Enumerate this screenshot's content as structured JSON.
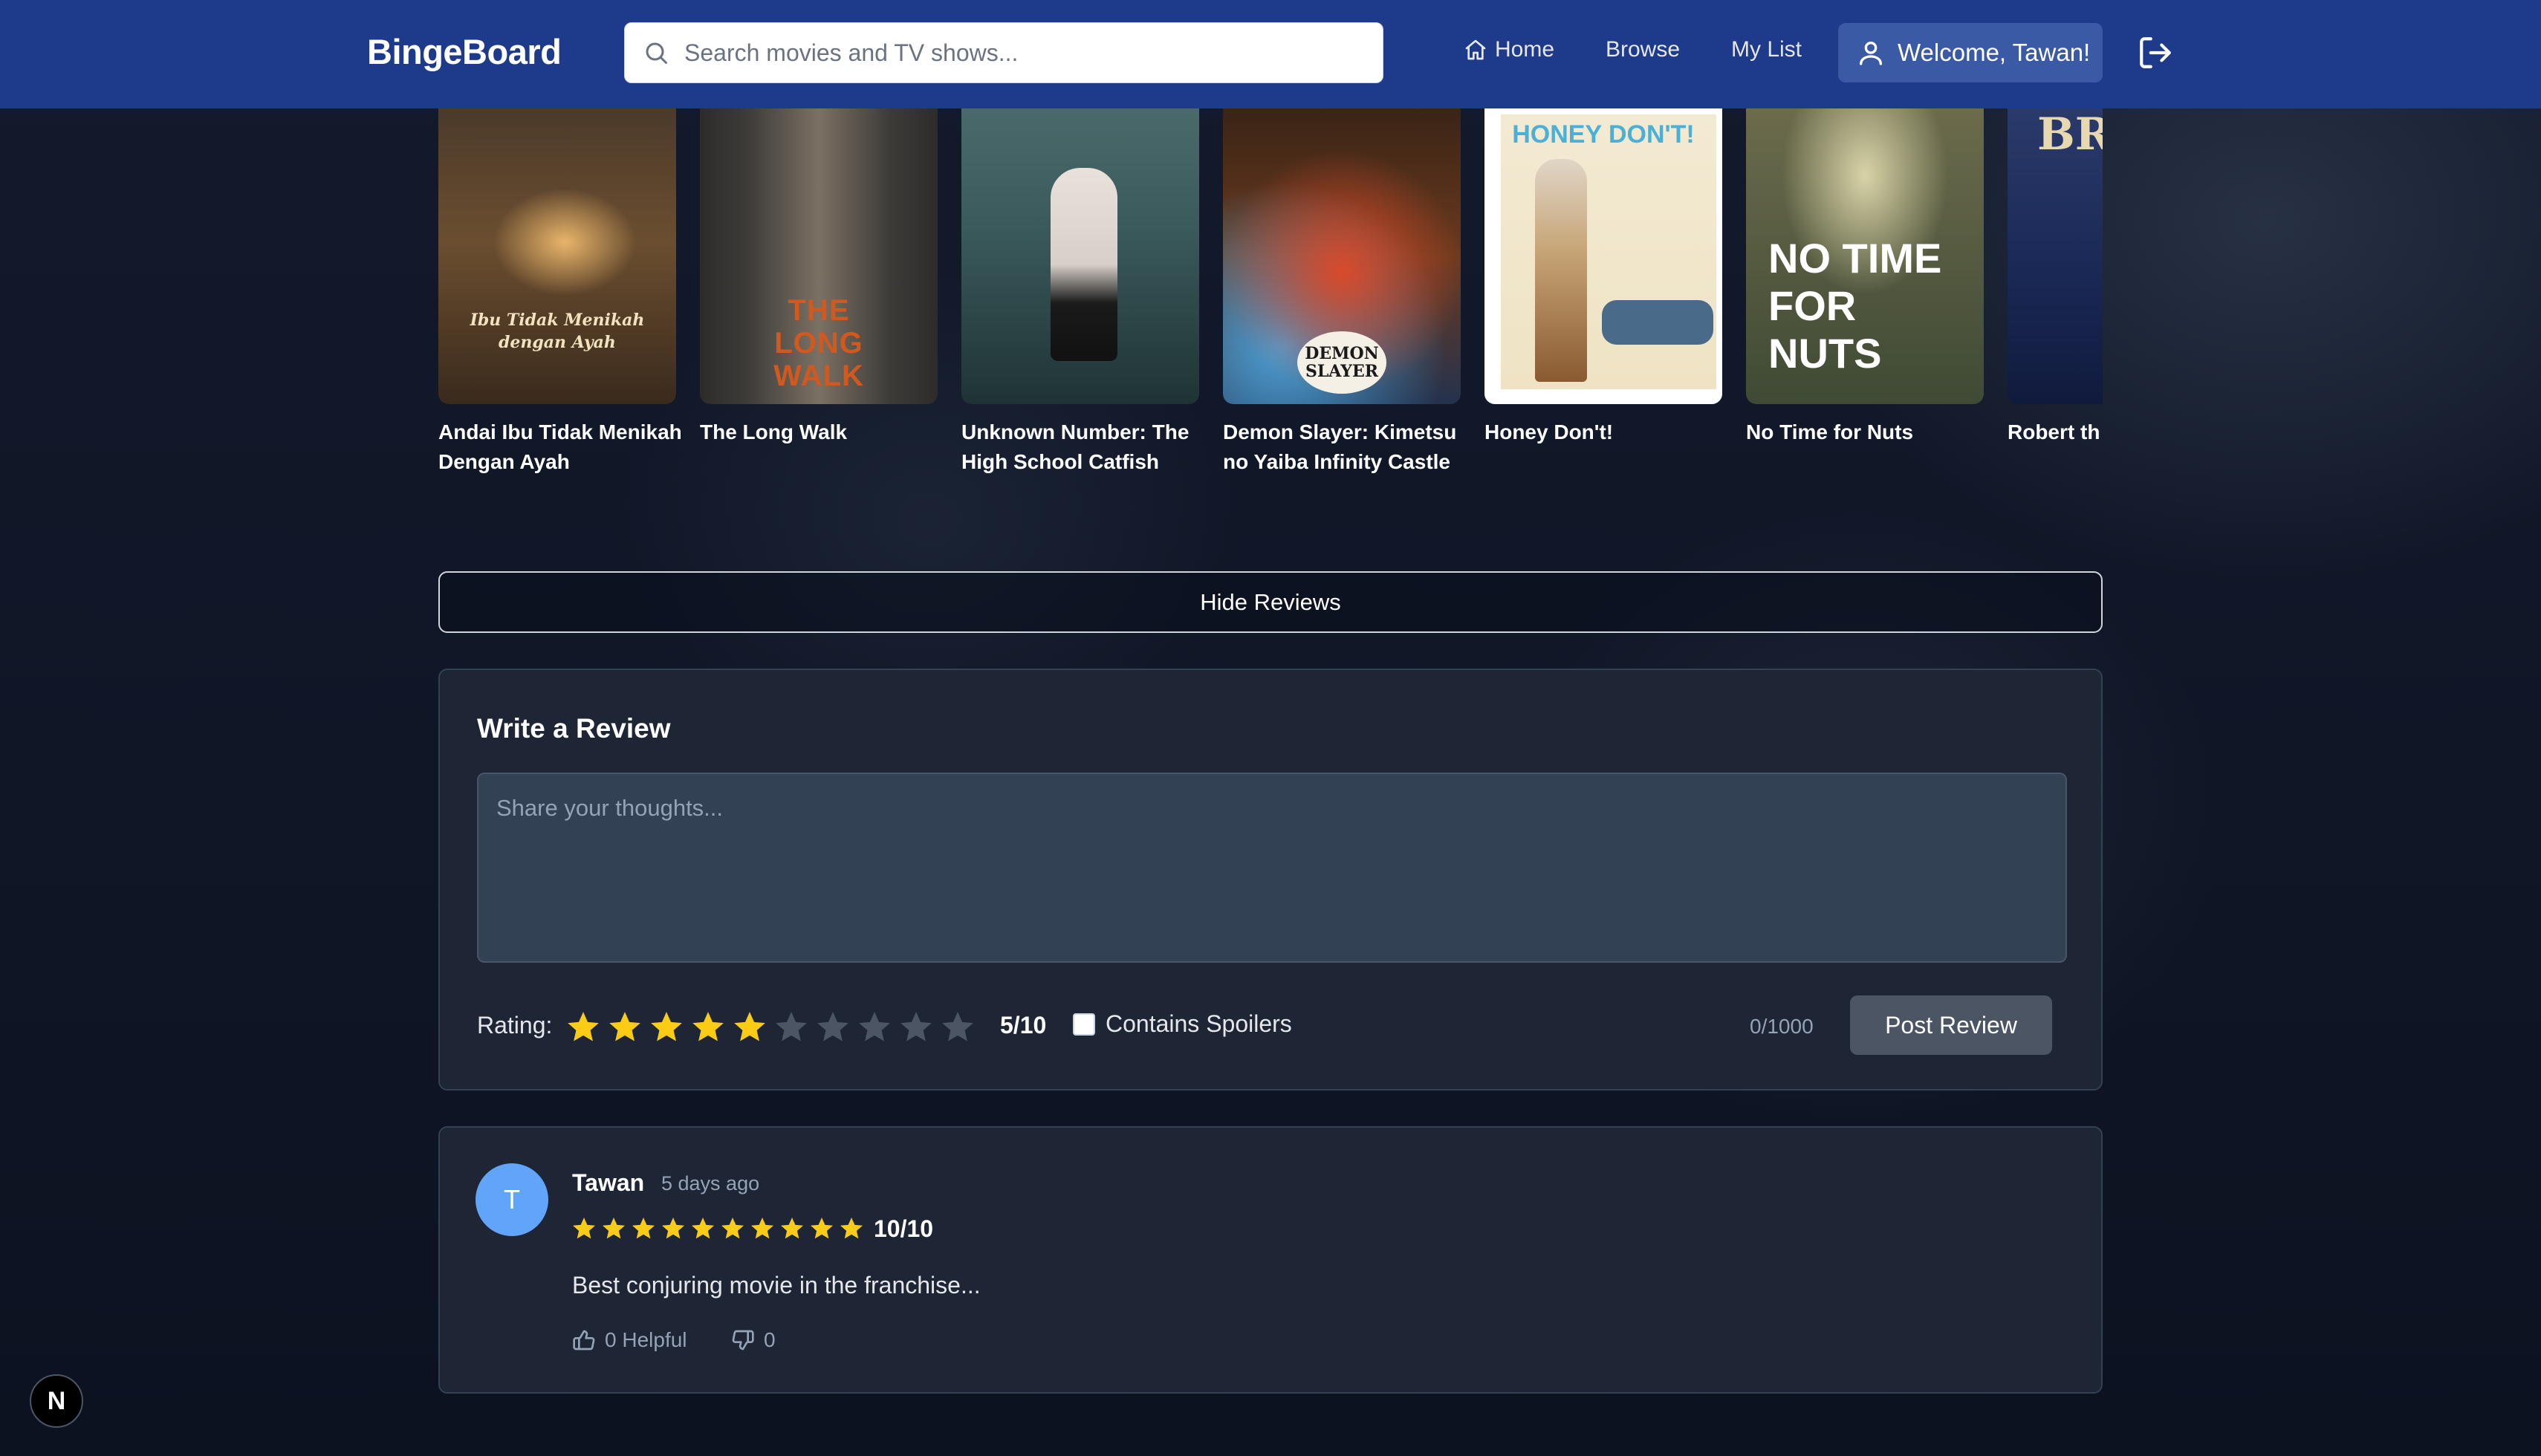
{
  "app": {
    "name": "BingeBoard"
  },
  "header": {
    "search_placeholder": "Search movies and TV shows...",
    "nav": {
      "home": "Home",
      "browse": "Browse",
      "my_list": "My List"
    },
    "welcome": "Welcome, Tawan!",
    "icons": {
      "search": "search-icon",
      "home": "home-icon",
      "user": "user-icon",
      "logout": "logout-icon"
    }
  },
  "posters": [
    {
      "title": "Andai Ibu Tidak Menikah Dengan Ayah",
      "art_text": "Ibu Tidak Menikah dengan Ayah"
    },
    {
      "title": "The Long Walk",
      "art_text": "THE LONG WALK"
    },
    {
      "title": "Unknown Number: The High School Catfish",
      "art_text": ""
    },
    {
      "title": "Demon Slayer: Kimetsu no Yaiba Infinity Castle",
      "art_text": "DEMON SLAYER"
    },
    {
      "title": "Honey Don't!",
      "art_text": "HONEY DON'T!"
    },
    {
      "title": "No Time for Nuts",
      "art_text": "NO TIME FOR NUTS"
    },
    {
      "title": "Robert th",
      "art_text": "BR"
    }
  ],
  "reviews_toggle": {
    "label": "Hide Reviews"
  },
  "write_review": {
    "title": "Write a Review",
    "placeholder": "Share your thoughts...",
    "rating_label": "Rating:",
    "rating": 5,
    "rating_max": 10,
    "rating_text": "5/10",
    "spoiler_label": "Contains Spoilers",
    "spoiler_checked": false,
    "char_count": "0/1000",
    "submit_label": "Post Review"
  },
  "reviews": [
    {
      "avatar_initial": "T",
      "name": "Tawan",
      "date": "5 days ago",
      "rating": 10,
      "rating_text": "10/10",
      "text": "Best conjuring movie in the franchise...",
      "helpful_label": "0 Helpful",
      "unhelpful_count": "0"
    }
  ],
  "dev_badge": "N",
  "colors": {
    "header_bg": "#1e3a8a",
    "star_filled": "#facc15",
    "star_empty": "#4b5563",
    "card_bg": "#1e2535",
    "avatar_bg": "#60a5fa"
  }
}
